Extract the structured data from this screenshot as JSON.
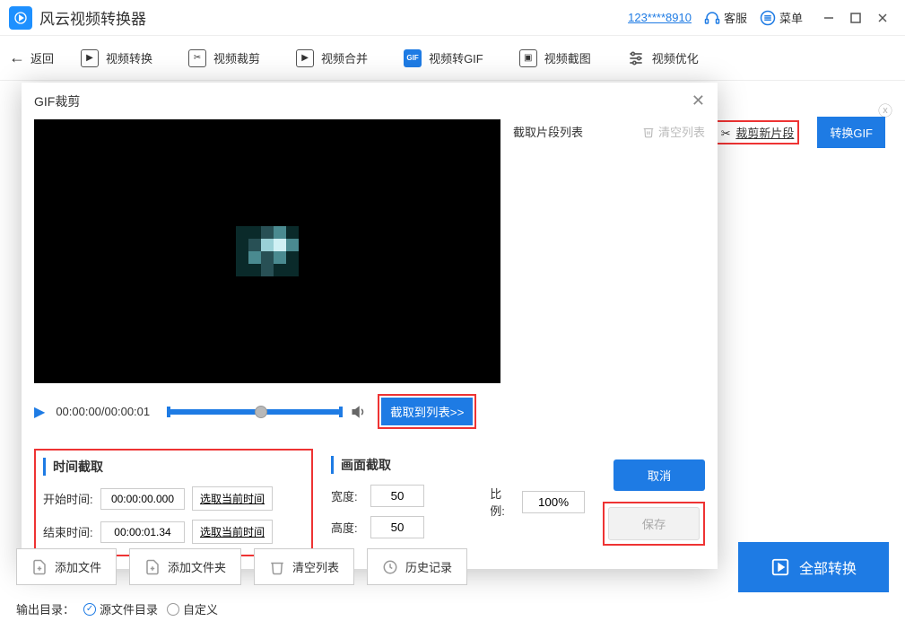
{
  "app": {
    "title": "风云视频转换器"
  },
  "titlebar": {
    "user_id": "123****8910",
    "support": "客服",
    "menu": "菜单"
  },
  "toolbar": {
    "back": "返回",
    "tabs": [
      {
        "label": "视频转换"
      },
      {
        "label": "视频裁剪"
      },
      {
        "label": "视频合并"
      },
      {
        "label": "视频转GIF"
      },
      {
        "label": "视频截图"
      },
      {
        "label": "视频优化"
      }
    ]
  },
  "bg": {
    "clip_new": "裁剪新片段",
    "convert_gif": "转换GIF"
  },
  "modal": {
    "title": "GIF裁剪",
    "clip_list_title": "截取片段列表",
    "clear_list": "清空列表",
    "timecode": "00:00:00/00:00:01",
    "clip_to_list": "截取到列表>>",
    "time_group": {
      "title": "时间截取",
      "start_label": "开始时间:",
      "start_value": "00:00:00.000",
      "end_label": "结束时间:",
      "end_value": "00:00:01.34",
      "select_current": "选取当前时间"
    },
    "frame_group": {
      "title": "画面截取",
      "width_label": "宽度:",
      "width_value": "50",
      "height_label": "高度:",
      "height_value": "50"
    },
    "ratio": {
      "label": "比例:",
      "value": "100%"
    },
    "cancel": "取消",
    "save": "保存"
  },
  "bottom": {
    "add_file": "添加文件",
    "add_folder": "添加文件夹",
    "clear_list": "清空列表",
    "history": "历史记录",
    "convert_all": "全部转换"
  },
  "output": {
    "label": "输出目录：",
    "source_dir": "源文件目录",
    "custom": "自定义"
  }
}
